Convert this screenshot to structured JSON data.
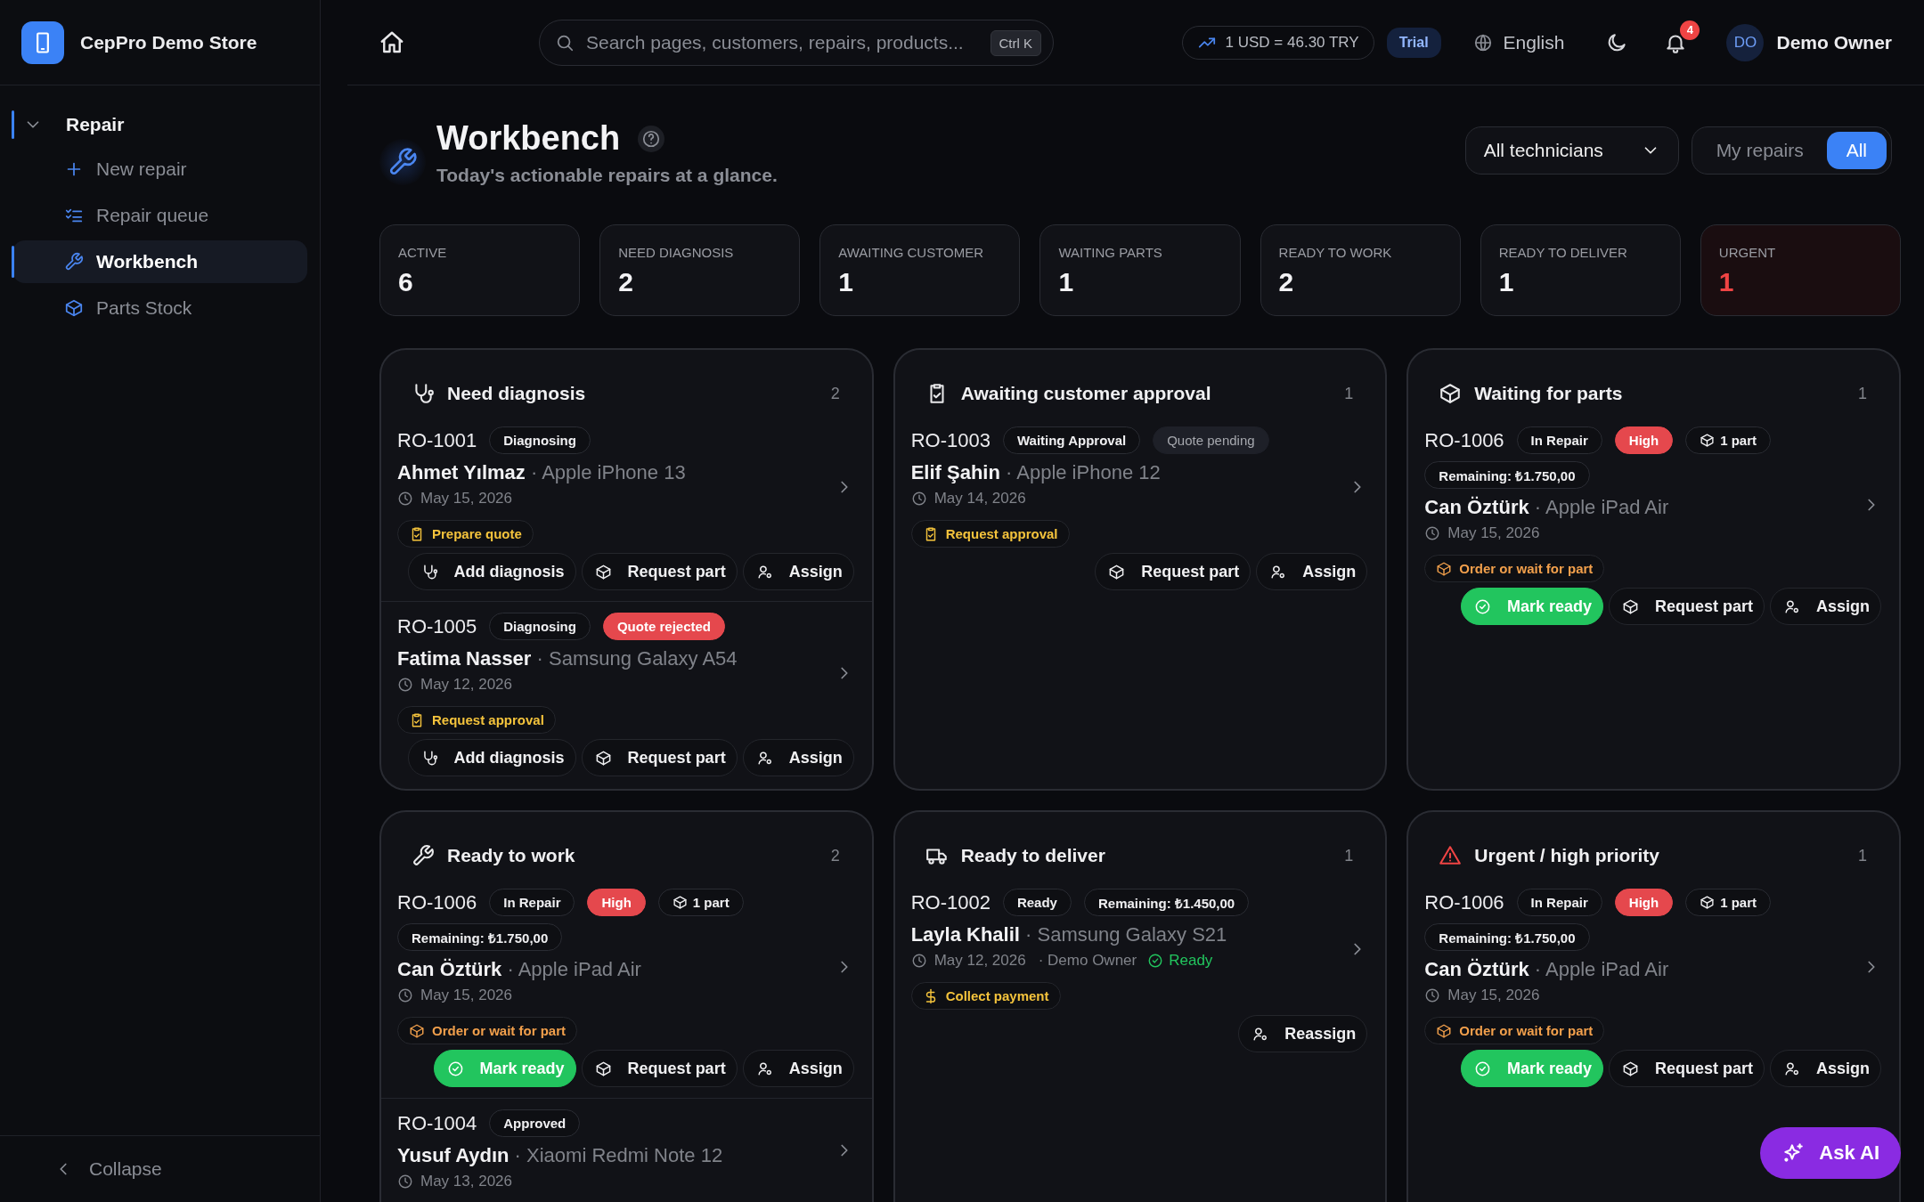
{
  "brand": {
    "name": "CepPro Demo Store"
  },
  "sidebar": {
    "group": {
      "label": "Repair",
      "expanded": true
    },
    "items": [
      {
        "label": "New repair",
        "kind": "new",
        "selected": false
      },
      {
        "label": "Repair queue",
        "kind": "queue",
        "selected": false
      },
      {
        "label": "Workbench",
        "kind": "bench",
        "selected": true
      },
      {
        "label": "Parts Stock",
        "kind": "stock",
        "selected": false
      }
    ],
    "collapse": "Collapse"
  },
  "topbar": {
    "search": {
      "placeholder": "Search pages, customers, repairs, products...",
      "shortcut": "Ctrl K"
    },
    "rate": "1 USD = 46.30 TRY",
    "plan": "Trial",
    "language": "English",
    "notifications": "4",
    "user": {
      "initials": "DO",
      "name": "Demo Owner"
    }
  },
  "header": {
    "title": "Workbench",
    "subtitle": "Today's actionable repairs at a glance.",
    "technician_filter": "All technicians",
    "scope": [
      {
        "label": "My repairs",
        "selected": false
      },
      {
        "label": "All",
        "selected": true
      }
    ]
  },
  "stats": [
    {
      "label": "ACTIVE",
      "value": "6",
      "alert": false
    },
    {
      "label": "NEED DIAGNOSIS",
      "value": "2",
      "alert": false
    },
    {
      "label": "AWAITING CUSTOMER",
      "value": "1",
      "alert": false
    },
    {
      "label": "WAITING PARTS",
      "value": "1",
      "alert": false
    },
    {
      "label": "READY TO WORK",
      "value": "2",
      "alert": false
    },
    {
      "label": "READY TO DELIVER",
      "value": "1",
      "alert": false
    },
    {
      "label": "URGENT",
      "value": "1",
      "alert": true
    }
  ],
  "panels": [
    {
      "title": "Need diagnosis",
      "kind": "diagnosis",
      "count": "2",
      "repairs": [
        {
          "id": "RO-1001",
          "tags": [
            {
              "label": "Diagnosing",
              "kind": "status"
            }
          ],
          "customer": "Ahmet Yılmaz",
          "device": "· Apple iPhone 13",
          "date": "May 15, 2026",
          "action": {
            "label": "Prepare quote",
            "kind": "quote"
          },
          "buttons": [
            {
              "label": "Add diagnosis",
              "kind": "diagnosis"
            },
            {
              "label": "Request part",
              "kind": "part"
            },
            {
              "label": "Assign",
              "kind": "assign"
            }
          ]
        },
        {
          "id": "RO-1005",
          "tags": [
            {
              "label": "Diagnosing",
              "kind": "status"
            },
            {
              "label": "Quote rejected",
              "kind": "danger"
            }
          ],
          "customer": "Fatima Nasser",
          "device": "· Samsung Galaxy A54",
          "date": "May 12, 2026",
          "action": {
            "label": "Request approval",
            "kind": "approval"
          },
          "buttons": [
            {
              "label": "Add diagnosis",
              "kind": "diagnosis"
            },
            {
              "label": "Request part",
              "kind": "part"
            },
            {
              "label": "Assign",
              "kind": "assign"
            }
          ]
        }
      ]
    },
    {
      "title": "Awaiting customer approval",
      "kind": "approval",
      "count": "1",
      "repairs": [
        {
          "id": "RO-1003",
          "tags": [
            {
              "label": "Waiting Approval",
              "kind": "status"
            },
            {
              "label": "Quote pending",
              "kind": "muted"
            }
          ],
          "customer": "Elif Şahin",
          "device": "· Apple iPhone 12",
          "date": "May 14, 2026",
          "action": {
            "label": "Request approval",
            "kind": "approval"
          },
          "buttons": [
            {
              "label": "Request part",
              "kind": "part"
            },
            {
              "label": "Assign",
              "kind": "assign"
            }
          ]
        }
      ]
    },
    {
      "title": "Waiting for parts",
      "kind": "parts",
      "count": "1",
      "repairs": [
        {
          "id": "RO-1006",
          "tags": [
            {
              "label": "In Repair",
              "kind": "status"
            },
            {
              "label": "High",
              "kind": "danger"
            },
            {
              "label": "1 part",
              "kind": "parts"
            },
            {
              "label": "Remaining: ₺1.750,00",
              "kind": "status"
            }
          ],
          "customer": "Can Öztürk",
          "device": "· Apple iPad Air",
          "date": "May 15, 2026",
          "action": {
            "label": "Order or wait for part",
            "kind": "part"
          },
          "buttons": [
            {
              "label": "Mark ready",
              "kind": "ready"
            },
            {
              "label": "Request part",
              "kind": "part"
            },
            {
              "label": "Assign",
              "kind": "assign"
            }
          ]
        }
      ]
    },
    {
      "title": "Ready to work",
      "kind": "work",
      "count": "2",
      "repairs": [
        {
          "id": "RO-1006",
          "tags": [
            {
              "label": "In Repair",
              "kind": "status"
            },
            {
              "label": "High",
              "kind": "danger"
            },
            {
              "label": "1 part",
              "kind": "parts"
            },
            {
              "label": "Remaining: ₺1.750,00",
              "kind": "status"
            }
          ],
          "customer": "Can Öztürk",
          "device": "· Apple iPad Air",
          "date": "May 15, 2026",
          "action": {
            "label": "Order or wait for part",
            "kind": "part"
          },
          "buttons": [
            {
              "label": "Mark ready",
              "kind": "ready"
            },
            {
              "label": "Request part",
              "kind": "part"
            },
            {
              "label": "Assign",
              "kind": "assign"
            }
          ]
        },
        {
          "id": "RO-1004",
          "tags": [
            {
              "label": "Approved",
              "kind": "status"
            }
          ],
          "customer": "Yusuf Aydın",
          "device": "· Xiaomi Redmi Note 12",
          "date": "May 13, 2026"
        }
      ]
    },
    {
      "title": "Ready to deliver",
      "kind": "deliver",
      "count": "1",
      "repairs": [
        {
          "id": "RO-1002",
          "tags": [
            {
              "label": "Ready",
              "kind": "status"
            },
            {
              "label": "Remaining: ₺1.450,00",
              "kind": "status"
            }
          ],
          "customer": "Layla Khalil",
          "device": "· Samsung Galaxy S21",
          "date": "May 12, 2026",
          "assignee": "· Demo Owner",
          "state": "Ready",
          "action": {
            "label": "Collect payment",
            "kind": "payment"
          },
          "buttons": [
            {
              "label": "Reassign",
              "kind": "assign"
            }
          ]
        }
      ]
    },
    {
      "title": "Urgent / high priority",
      "kind": "urgent",
      "count": "1",
      "repairs": [
        {
          "id": "RO-1006",
          "tags": [
            {
              "label": "In Repair",
              "kind": "status"
            },
            {
              "label": "High",
              "kind": "danger"
            },
            {
              "label": "1 part",
              "kind": "parts"
            },
            {
              "label": "Remaining: ₺1.750,00",
              "kind": "status"
            }
          ],
          "customer": "Can Öztürk",
          "device": "· Apple iPad Air",
          "date": "May 15, 2026",
          "action": {
            "label": "Order or wait for part",
            "kind": "part"
          },
          "buttons": [
            {
              "label": "Mark ready",
              "kind": "ready"
            },
            {
              "label": "Request part",
              "kind": "part"
            },
            {
              "label": "Assign",
              "kind": "assign"
            }
          ]
        }
      ]
    }
  ],
  "assistant": {
    "label": "Ask AI"
  }
}
